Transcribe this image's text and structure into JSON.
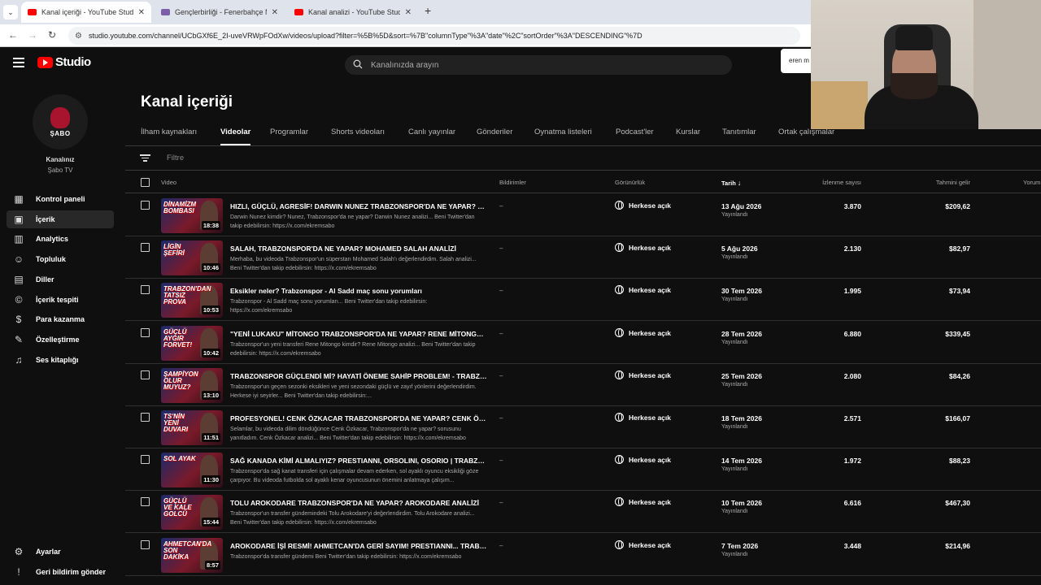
{
  "browser": {
    "tabs": [
      {
        "title": "Kanal içeriği - YouTube Studio",
        "favicon_color": "#ff0000",
        "active": true
      },
      {
        "title": "Gençlerbirliği - Fenerbahçe Ma",
        "favicon_color": "#7b5ea7",
        "active": false
      },
      {
        "title": "Kanal analizi - YouTube Studio",
        "favicon_color": "#ff0000",
        "active": false
      }
    ],
    "url": "studio.youtube.com/channel/UCbGXf6E_2I-uveVRWpFOdXw/videos/upload?filter=%5B%5D&sort=%7B\"columnType\"%3A\"date\"%2C\"sortOrder\"%3A\"DESCENDING\"%7D"
  },
  "header": {
    "logo_text": "Studio",
    "search_placeholder": "Kanalınızda arayın",
    "popup_text": "eren m"
  },
  "sidebar": {
    "avatar_text": "ŞABO",
    "channel_caption": "Kanalınız",
    "channel_name": "Şabo TV",
    "items": [
      {
        "label": "Kontrol paneli",
        "icon": "dashboard-icon",
        "glyph": "▦"
      },
      {
        "label": "İçerik",
        "icon": "content-icon",
        "glyph": "▣",
        "active": true
      },
      {
        "label": "Analytics",
        "icon": "analytics-icon",
        "glyph": "▥"
      },
      {
        "label": "Topluluk",
        "icon": "community-icon",
        "glyph": "☺"
      },
      {
        "label": "Diller",
        "icon": "subtitles-icon",
        "glyph": "▤"
      },
      {
        "label": "İçerik tespiti",
        "icon": "copyright-icon",
        "glyph": "©"
      },
      {
        "label": "Para kazanma",
        "icon": "monetization-icon",
        "glyph": "$"
      },
      {
        "label": "Özelleştirme",
        "icon": "customization-icon",
        "glyph": "✎"
      },
      {
        "label": "Ses kitaplığı",
        "icon": "audio-library-icon",
        "glyph": "♫"
      }
    ],
    "footer": [
      {
        "label": "Ayarlar",
        "icon": "settings-icon",
        "glyph": "⚙"
      },
      {
        "label": "Geri bildirim gönder",
        "icon": "feedback-icon",
        "glyph": "!"
      }
    ]
  },
  "main": {
    "title": "Kanal içeriği",
    "tabs": [
      "İlham kaynakları",
      "Videolar",
      "Programlar",
      "Shorts videoları",
      "Canlı yayınlar",
      "Gönderiler",
      "Oynatma listeleri",
      "Podcast'ler",
      "Kurslar",
      "Tanıtımlar",
      "Ortak çalışmalar"
    ],
    "active_tab": "Videolar",
    "filter_placeholder": "Filtre",
    "columns": {
      "video": "Video",
      "restrictions": "Bildirimler",
      "visibility": "Görünürlük",
      "date": "Tarih",
      "views": "İzlenme sayısı",
      "revenue": "Tahmini gelir",
      "comments": "Yorum"
    },
    "rows": [
      {
        "thumb_text": "DİNAMİZM BOMBASI",
        "duration": "18:38",
        "title": "HIZLI, GÜÇLÜ, AGRESİF! DARWIN NUNEZ TRABZONSPOR'DA NE YAPAR? NUNE...",
        "desc": "Darwin Nunez kimdir? Nunez, Trabzonspor'da ne yapar? Darwin Nunez analizi... Beni Twitter'dan takip edebilirsin: https://x.com/ekremsabo",
        "restriction": "–",
        "visibility": "Herkese açık",
        "date": "13 Ağu 2026",
        "status": "Yayınlandı",
        "views": "3.870",
        "revenue": "$209,62"
      },
      {
        "thumb_text": "LİGİN ŞEFİRİ",
        "duration": "10:46",
        "title": "SALAH, TRABZONSPOR'DA NE YAPAR? MOHAMED SALAH ANALİZİ",
        "desc": "Merhaba, bu videoda Trabzonspor'un süperstarı Mohamed Salah'ı değerlendirdim. Salah analizi... Beni Twitter'dan takip edebilirsin: https://x.com/ekremsabo",
        "restriction": "–",
        "visibility": "Herkese açık",
        "date": "5 Ağu 2026",
        "status": "Yayınlandı",
        "views": "2.130",
        "revenue": "$82,97"
      },
      {
        "thumb_text": "TRABZON'DAN TATSIZ PROVA",
        "duration": "10:53",
        "title": "Eksikler neler? Trabzonspor - Al Sadd maç sonu yorumları",
        "desc": "Trabzonspor - Al Sadd maç sonu yorumları... Beni Twitter'dan takip edebilirsin: https://x.com/ekremsabo",
        "restriction": "–",
        "visibility": "Herkese açık",
        "date": "30 Tem 2026",
        "status": "Yayınlandı",
        "views": "1.995",
        "revenue": "$73,94"
      },
      {
        "thumb_text": "GÜÇLÜ AYGIR FORVET!",
        "duration": "10:42",
        "title": "\"YENİ LUKAKU\" MİTONGO TRABZONSPOR'DA NE YAPAR? RENE MİTONGO ANA...",
        "desc": "Trabzonspor'un yeni transferi Rene Mitongo kimdir? Rene Mitongo analizi... Beni Twitter'dan takip edebilirsin: https://x.com/ekremsabo",
        "restriction": "–",
        "visibility": "Herkese açık",
        "date": "28 Tem 2026",
        "status": "Yayınlandı",
        "views": "6.880",
        "revenue": "$339,45"
      },
      {
        "thumb_text": "ŞAMPİYON OLUR MUYUZ?",
        "duration": "13:10",
        "title": "TRABZONSPOR GÜÇLENDİ Mİ? HAYATİ ÖNEME SAHİP PROBLEM! - TRABZONS...",
        "desc": "Trabzonspor'un geçen sezonki eksikleri ve yeni sezondaki güçlü ve zayıf yönlerini değerlendirdim. Herkese iyi seyirler... Beni Twitter'dan takip edebilirsin:...",
        "restriction": "–",
        "visibility": "Herkese açık",
        "date": "25 Tem 2026",
        "status": "Yayınlandı",
        "views": "2.080",
        "revenue": "$84,26"
      },
      {
        "thumb_text": "TS'NİN YENİ DUVARI",
        "duration": "11:51",
        "title": "PROFESYONEL! CENK ÖZKACAR TRABZONSPOR'DA NE YAPAR? CENK ÖZKACA...",
        "desc": "Selamlar, bu videoda dilim döndüğünce Cenk Özkacar, Trabzonspor'da ne yapar? sorusunu yanıtladım. Cenk Özkacar analizi... Beni Twitter'dan takip edebilirsin: https://x.com/ekremsabo",
        "restriction": "–",
        "visibility": "Herkese açık",
        "date": "18 Tem 2026",
        "status": "Yayınlandı",
        "views": "2.571",
        "revenue": "$166,07"
      },
      {
        "thumb_text": "SOL AYAK",
        "duration": "11:30",
        "title": "SAĞ KANADA KİMİ ALMALIYIZ? PRESTIANNI, ORSOLINI, OSORIO | TRABZONSP...",
        "desc": "Trabzonspor'da sağ kanat transferi için çalışmalar devam ederken, sol ayaklı oyuncu eksikliği göze çarpıyor. Bu videoda futbolda sol ayaklı kenar oyuncusunun önemini anlatmaya çalışım...",
        "restriction": "–",
        "visibility": "Herkese açık",
        "date": "14 Tem 2026",
        "status": "Yayınlandı",
        "views": "1.972",
        "revenue": "$88,23"
      },
      {
        "thumb_text": "GÜÇLÜ VE KALE GOLCÜ",
        "duration": "15:44",
        "title": "TOLU AROKODARE TRABZONSPOR'DA NE YAPAR? AROKODARE ANALİZİ",
        "desc": "Trabzonspor'un transfer gündemindeki Tolu Arokodare'yi değerlendirdim. Tolu Arokodare analizi... Beni Twitter'dan takip edebilirsin: https://x.com/ekremsabo",
        "restriction": "–",
        "visibility": "Herkese açık",
        "date": "10 Tem 2026",
        "status": "Yayınlandı",
        "views": "6.616",
        "revenue": "$467,30"
      },
      {
        "thumb_text": "AHMETCAN'DA SON DAKİKA",
        "duration": "8:57",
        "title": "AROKODARE İŞİ RESMİ! AHMETCAN'DA GERİ SAYIM! PRESTIANNI... TRABZON...",
        "desc": "Trabzonspor'da transfer gündemi Beni Twitter'dan takip edebilirsin: https://x.com/ekremsabo",
        "restriction": "–",
        "visibility": "Herkese açık",
        "date": "7 Tem 2026",
        "status": "Yayınlandı",
        "views": "3.448",
        "revenue": "$214,96"
      }
    ]
  }
}
